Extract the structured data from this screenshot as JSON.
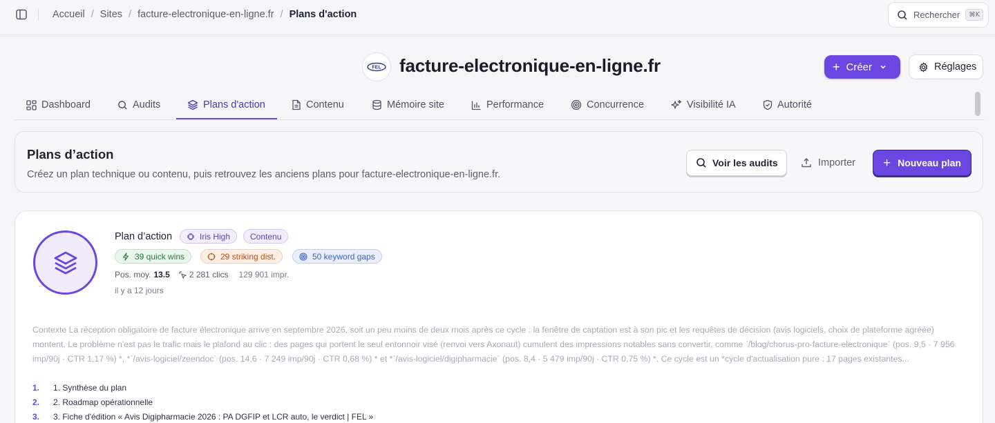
{
  "topbar": {
    "breadcrumbs": [
      "Accueil",
      "Sites",
      "facture-electronique-en-ligne.fr",
      "Plans d'action"
    ],
    "search_label": "Rechercher",
    "search_shortcut": "⌘K"
  },
  "site": {
    "title": "facture-electronique-en-ligne.fr",
    "logo_text": "FEL"
  },
  "actions": {
    "create_label": "Créer",
    "settings_label": "Réglages"
  },
  "tabs": [
    {
      "label": "Dashboard",
      "icon": "grid-icon"
    },
    {
      "label": "Audits",
      "icon": "search-icon"
    },
    {
      "label": "Plans d'action",
      "icon": "layers-icon",
      "active": true
    },
    {
      "label": "Contenu",
      "icon": "document-icon"
    },
    {
      "label": "Mémoire site",
      "icon": "database-icon"
    },
    {
      "label": "Performance",
      "icon": "bar-chart-icon"
    },
    {
      "label": "Concurrence",
      "icon": "target-icon"
    },
    {
      "label": "Visibilité IA",
      "icon": "sparkles-icon"
    },
    {
      "label": "Autorité",
      "icon": "shield-icon"
    }
  ],
  "header_card": {
    "title": "Plans d’action",
    "subtitle": "Créez un plan technique ou contenu, puis retrouvez les anciens plans pour facture-electronique-en-ligne.fr.",
    "view_audits_label": "Voir les audits",
    "import_label": "Importer",
    "new_plan_label": "Nouveau plan"
  },
  "plan": {
    "name": "Plan d’action",
    "tags": {
      "model": "Iris High",
      "type": "Contenu",
      "quick_wins": "39 quick wins",
      "striking": "29 striking dist.",
      "keyword_gaps": "50 keyword gaps"
    },
    "stats": {
      "pos_label": "Pos. moy.",
      "pos_value": "13.5",
      "clicks": "2 281 clics",
      "impressions": "129 901 impr."
    },
    "age": "il y a 12 jours",
    "context": "Contexte La réception obligatoire de facture électronique arrive en septembre 2026, soit un peu moins de deux mois après ce cycle : la fenêtre de captation est à son pic et les requêtes de décision (avis logiciels, choix de plateforme agréée) montent. Le problème n'est pas le trafic mais le plafond au clic : des pages qui portent le seul entonnoir visé (renvoi vers Axonaut) cumulent des impressions notables sans convertir, comme `/blog/chorus-pro-facture-electronique` (pos. 9,5 · 7 956 imp/90j · CTR 1,17 %) *, *`/avis-logiciel/zeendoc` (pos. 14,6 · 7 249 imp/90j · CTR 0,68 %) * et *`/avis-logiciel/digipharmacie` (pos. 8,4 · 5 479 imp/90j · CTR 0,75 %) *. Ce cycle est un *cycle d'actualisation pure : 17 pages existantes...",
    "toc": [
      {
        "num": "1.",
        "text": "1. Synthèse du plan"
      },
      {
        "num": "2.",
        "text": "2. Roadmap opérationnelle"
      },
      {
        "num": "3.",
        "text": "3. Fiche d'édition « Avis Digipharmacie 2026 : PA DGFIP et LCR auto, le verdict | FEL »"
      }
    ]
  },
  "colors": {
    "accent": "#6b46e0",
    "accent_dark": "#3e2a8e",
    "quick_wins": "#2f7a4a",
    "striking": "#b4561c",
    "keyword_gaps": "#3a63c6"
  }
}
